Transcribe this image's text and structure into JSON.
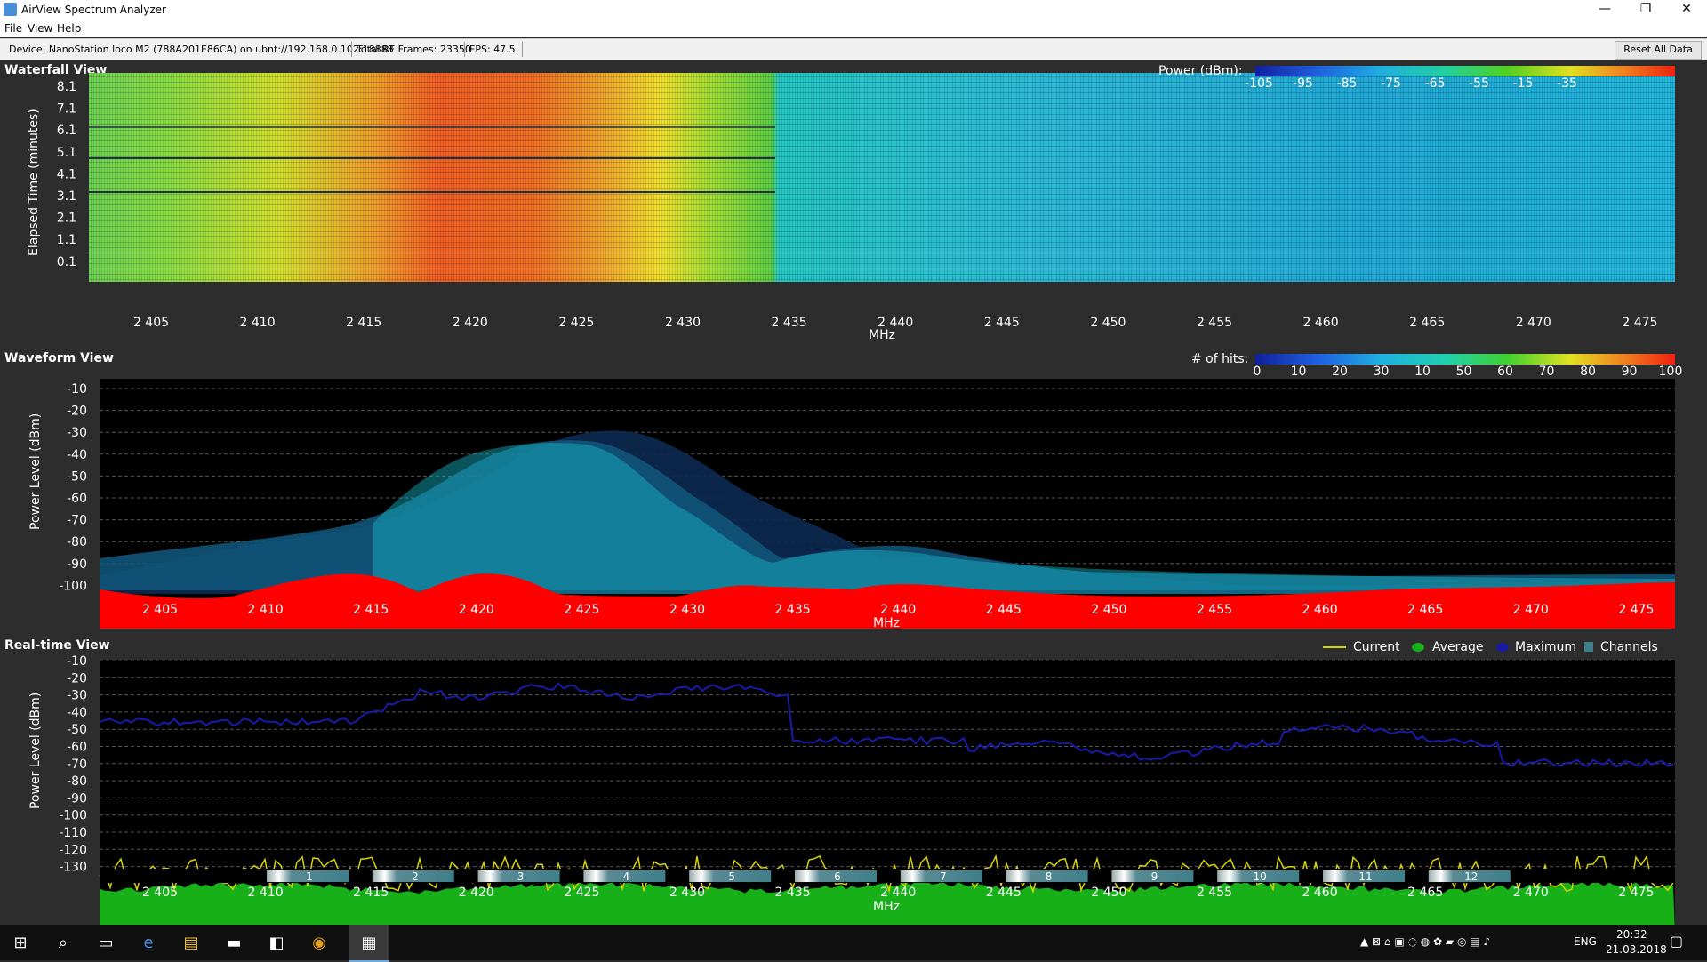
{
  "window": {
    "title": "AirView Spectrum Analyzer",
    "controls": [
      "—",
      "❐",
      "✕"
    ]
  },
  "menu": [
    "File",
    "View",
    "Help"
  ],
  "status": {
    "device": "Device: NanoStation loco M2 (788A201E86CA) on ubnt://192.168.0.102:18888",
    "frames": "Total RF Frames: 23350",
    "fps": "FPS: 47.5",
    "reset_label": "Reset All Data"
  },
  "freq_ticks": [
    "2 405",
    "2 410",
    "2 415",
    "2 420",
    "2 425",
    "2 430",
    "2 435",
    "2 440",
    "2 445",
    "2 450",
    "2 455",
    "2 460",
    "2 465",
    "2 470",
    "2 475"
  ],
  "x_title": "MHz",
  "waterfall": {
    "title": "Waterfall View",
    "ylabel": "Elapsed Time (minutes)",
    "yticks": [
      "8.1",
      "7.1",
      "6.1",
      "5.1",
      "4.1",
      "3.1",
      "2.1",
      "1.1",
      "0.1"
    ],
    "legend_title": "Power (dBm):",
    "legend_ticks": [
      "-105",
      "-95",
      "-85",
      "-75",
      "-65",
      "-55",
      "-15",
      "-35"
    ]
  },
  "waveform": {
    "title": "Waveform View",
    "ylabel": "Power Level (dBm)",
    "yticks": [
      "-10",
      "-20",
      "-30",
      "-40",
      "-50",
      "-60",
      "-70",
      "-80",
      "-90",
      "-100"
    ],
    "legend_title": "# of hits:",
    "legend_ticks": [
      "0",
      "10",
      "20",
      "30",
      "10",
      "50",
      "60",
      "70",
      "80",
      "90",
      "100"
    ]
  },
  "realtime": {
    "title": "Real-time View",
    "ylabel": "Power Level (dBm)",
    "yticks": [
      "-10",
      "-20",
      "-30",
      "-40",
      "-50",
      "-60",
      "-70",
      "-80",
      "-90",
      "-100",
      "-110",
      "-120",
      "-130"
    ],
    "legend": {
      "current": "Current",
      "average": "Average",
      "maximum": "Maximum",
      "channels": "Channels"
    },
    "channels": [
      "1",
      "2",
      "3",
      "4",
      "5",
      "6",
      "7",
      "8",
      "9",
      "10",
      "11",
      "12"
    ]
  },
  "colors": {
    "current": "#d7d300",
    "average": "#18b018",
    "maximum": "#1a1aa8",
    "floor": "#ff0000"
  },
  "taskbar": {
    "lang": "ENG",
    "time": "20:32",
    "date": "21.03.2018",
    "icons": [
      "windows-start-icon",
      "search-icon",
      "task-view-icon",
      "edge-icon",
      "file-explorer-icon",
      "terminal-icon",
      "store-icon",
      "chrome-icon",
      "airview-icon"
    ]
  }
}
